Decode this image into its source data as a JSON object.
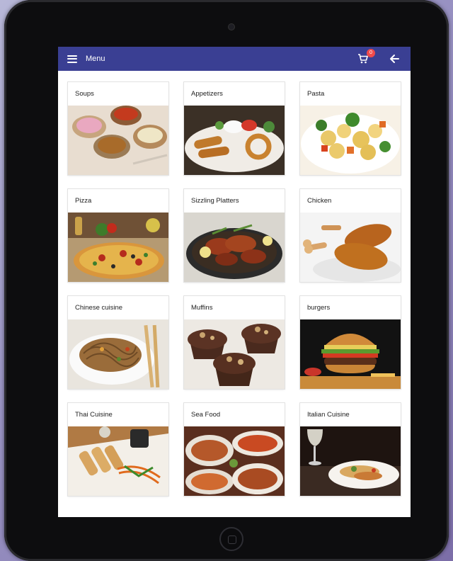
{
  "app": {
    "title": "Menu",
    "cart_count": "0",
    "accent": "#3a3f93",
    "badge_color": "#f04b4b"
  },
  "categories": [
    {
      "label": "Soups",
      "icon": "soups-photo"
    },
    {
      "label": "Appetizers",
      "icon": "appetizers-photo"
    },
    {
      "label": "Pasta",
      "icon": "pasta-photo"
    },
    {
      "label": "Pizza",
      "icon": "pizza-photo"
    },
    {
      "label": "Sizzling Platters",
      "icon": "sizzling-platters-photo"
    },
    {
      "label": "Chicken",
      "icon": "chicken-photo"
    },
    {
      "label": "Chinese cuisine",
      "icon": "chinese-cuisine-photo"
    },
    {
      "label": "Muffins",
      "icon": "muffins-photo"
    },
    {
      "label": "burgers",
      "icon": "burgers-photo"
    },
    {
      "label": "Thai Cuisine",
      "icon": "thai-cuisine-photo"
    },
    {
      "label": "Sea Food",
      "icon": "sea-food-photo"
    },
    {
      "label": "Italian Cuisine",
      "icon": "italian-cuisine-photo"
    }
  ]
}
